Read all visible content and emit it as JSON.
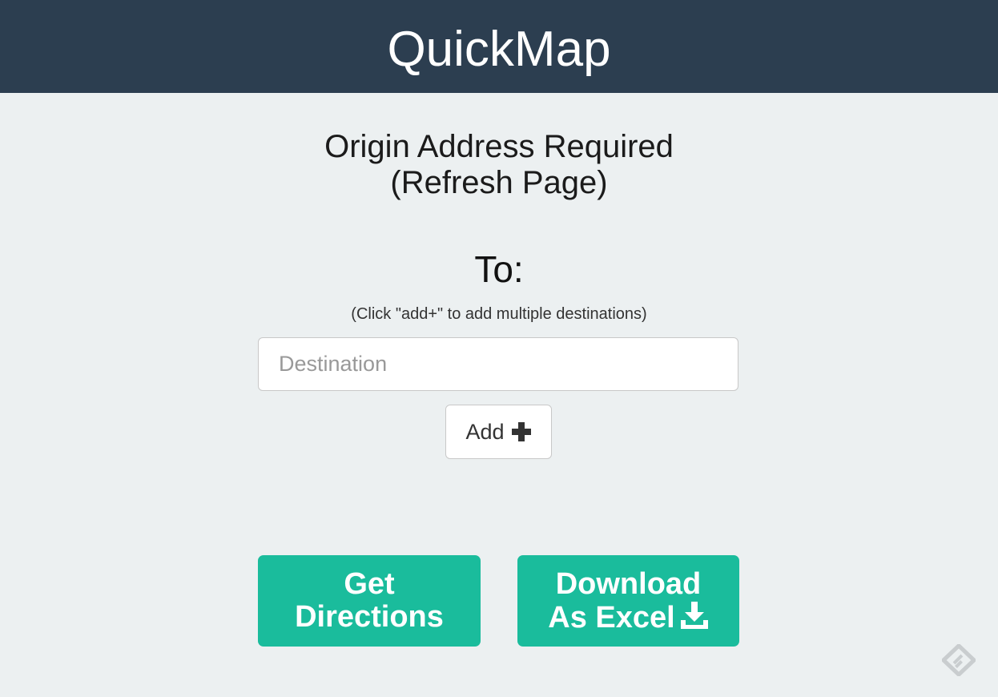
{
  "header": {
    "title": "QuickMap",
    "background_color": "#2c3e50"
  },
  "status": {
    "line1": "Origin Address Required",
    "line2": "(Refresh Page)"
  },
  "destination_section": {
    "label": "To:",
    "hint": "(Click \"add+\" to add multiple destinations)",
    "input_placeholder": "Destination",
    "input_value": "",
    "add_button": {
      "label": "Add",
      "icon": "plus-icon"
    }
  },
  "actions": {
    "get_directions": {
      "line1": "Get",
      "line2": "Directions"
    },
    "download_excel": {
      "line1": "Download",
      "line2": "As Excel",
      "icon": "download-icon"
    },
    "accent_color": "#1abc9c"
  },
  "corner_logo": {
    "icon": "feedly-logo-icon"
  }
}
